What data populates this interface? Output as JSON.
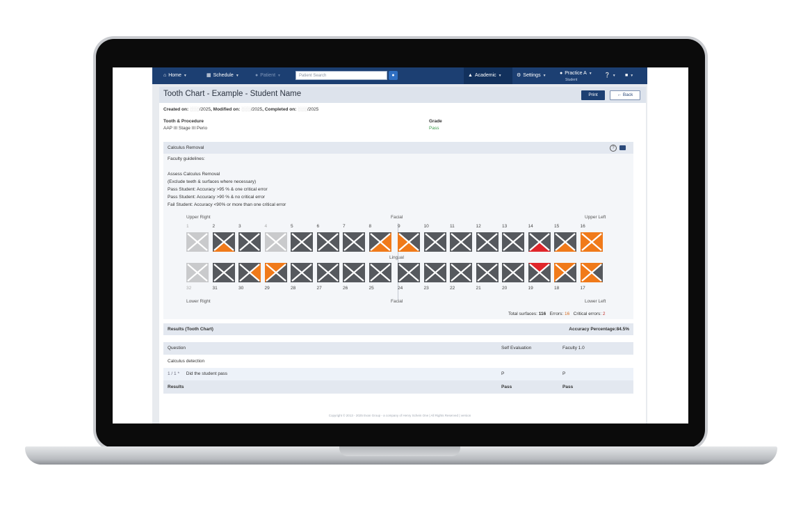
{
  "nav": {
    "home": "Home",
    "schedule": "Schedule",
    "patient": "Patient",
    "search_placeholder": "Patient Search",
    "academic": "Academic",
    "settings": "Settings",
    "practice": "Practice A",
    "practice_sub": "Student"
  },
  "page": {
    "title": "Tooth Chart - Example - Student Name",
    "print": "Print",
    "back": "Back",
    "created_label": "Created on:",
    "created_value": "/2025",
    "modified_label": ", Modified on:",
    "modified_value": "/2025",
    "completed_label": ", Completed on:",
    "completed_value": "/2025",
    "tooth_proc_label": "Tooth & Procedure",
    "tooth_proc_value": "AAP III Stage III Perio",
    "grade_label": "Grade",
    "grade_value": "Pass"
  },
  "section": {
    "title": "Calculus Removal",
    "guidelines": [
      "Faculty guidelines:",
      "Assess Calculus Removal",
      "(Exclude teeth & surfaces where necessary)",
      "Pass Student: Accuracy >95 % & one critical error",
      "Pass Student: Accuracy >90 % & no critical error",
      "Fail Student: Accuracy <90% or more than one critical error"
    ]
  },
  "chart": {
    "upper_right": "Upper Right",
    "upper_left": "Upper Left",
    "lower_right": "Lower Right",
    "lower_left": "Lower Left",
    "facial_top": "Facial",
    "lingual": "Lingual",
    "facial_bottom": "Facial",
    "upper_teeth": [
      {
        "n": "1",
        "state": "excluded",
        "marks": []
      },
      {
        "n": "2",
        "state": "active",
        "marks": [
          "bottom"
        ]
      },
      {
        "n": "3",
        "state": "active",
        "marks": []
      },
      {
        "n": "4",
        "state": "excluded",
        "marks": []
      },
      {
        "n": "5",
        "state": "active",
        "marks": []
      },
      {
        "n": "6",
        "state": "active",
        "marks": []
      },
      {
        "n": "7",
        "state": "active",
        "marks": []
      },
      {
        "n": "8",
        "state": "active",
        "marks": [
          "right",
          "bottom"
        ]
      },
      {
        "n": "9",
        "state": "active",
        "marks": [
          "left",
          "bottom"
        ]
      },
      {
        "n": "10",
        "state": "active",
        "marks": []
      },
      {
        "n": "11",
        "state": "active",
        "marks": []
      },
      {
        "n": "12",
        "state": "active",
        "marks": []
      },
      {
        "n": "13",
        "state": "active",
        "marks": []
      },
      {
        "n": "14",
        "state": "active",
        "marks": [
          "bottom-critical"
        ]
      },
      {
        "n": "15",
        "state": "active",
        "marks": [
          "bottom"
        ]
      },
      {
        "n": "16",
        "state": "active",
        "marks": [
          "top",
          "left",
          "right",
          "bottom"
        ]
      }
    ],
    "lower_teeth": [
      {
        "n": "32",
        "state": "excluded",
        "marks": []
      },
      {
        "n": "31",
        "state": "active",
        "marks": []
      },
      {
        "n": "30",
        "state": "active",
        "marks": [
          "right"
        ]
      },
      {
        "n": "29",
        "state": "active",
        "marks": [
          "top",
          "left"
        ]
      },
      {
        "n": "28",
        "state": "active",
        "marks": []
      },
      {
        "n": "27",
        "state": "active",
        "marks": []
      },
      {
        "n": "26",
        "state": "active",
        "marks": []
      },
      {
        "n": "25",
        "state": "active",
        "marks": []
      },
      {
        "n": "24",
        "state": "active",
        "marks": []
      },
      {
        "n": "23",
        "state": "active",
        "marks": []
      },
      {
        "n": "22",
        "state": "active",
        "marks": []
      },
      {
        "n": "21",
        "state": "active",
        "marks": []
      },
      {
        "n": "20",
        "state": "active",
        "marks": []
      },
      {
        "n": "19",
        "state": "active",
        "marks": [
          "top-critical"
        ]
      },
      {
        "n": "18",
        "state": "active",
        "marks": [
          "top",
          "left"
        ]
      },
      {
        "n": "17",
        "state": "active",
        "marks": [
          "top",
          "left",
          "bottom"
        ]
      }
    ],
    "colors": {
      "tooth": "#56595e",
      "excluded": "#c9cacc",
      "error": "#f07a1a",
      "critical": "#e0262b",
      "x": "#ffffff"
    },
    "total_surfaces_label": "Total surfaces:",
    "total_surfaces": "116",
    "errors_label": "Errors:",
    "errors": "16",
    "critical_label": "Critical errors:",
    "critical": "2"
  },
  "results": {
    "title": "Results (Tooth Chart)",
    "accuracy_label": "Accuracy Percentage:",
    "accuracy": "84.5%",
    "col_question": "Question",
    "col_self": "Self Evaluation",
    "col_faculty": "Faculty 1.0",
    "group": "Calculus detection",
    "q_index": "1 / 1 *",
    "q_text": "Did the student pass",
    "q_self": "P",
    "q_faculty": "P",
    "results_label": "Results",
    "results_self": "Pass",
    "results_faculty": "Pass"
  },
  "footer": "Copyright © 2013 - 2025 Evan Group - a company of Henry Schein One | All Rights Reserved | version"
}
